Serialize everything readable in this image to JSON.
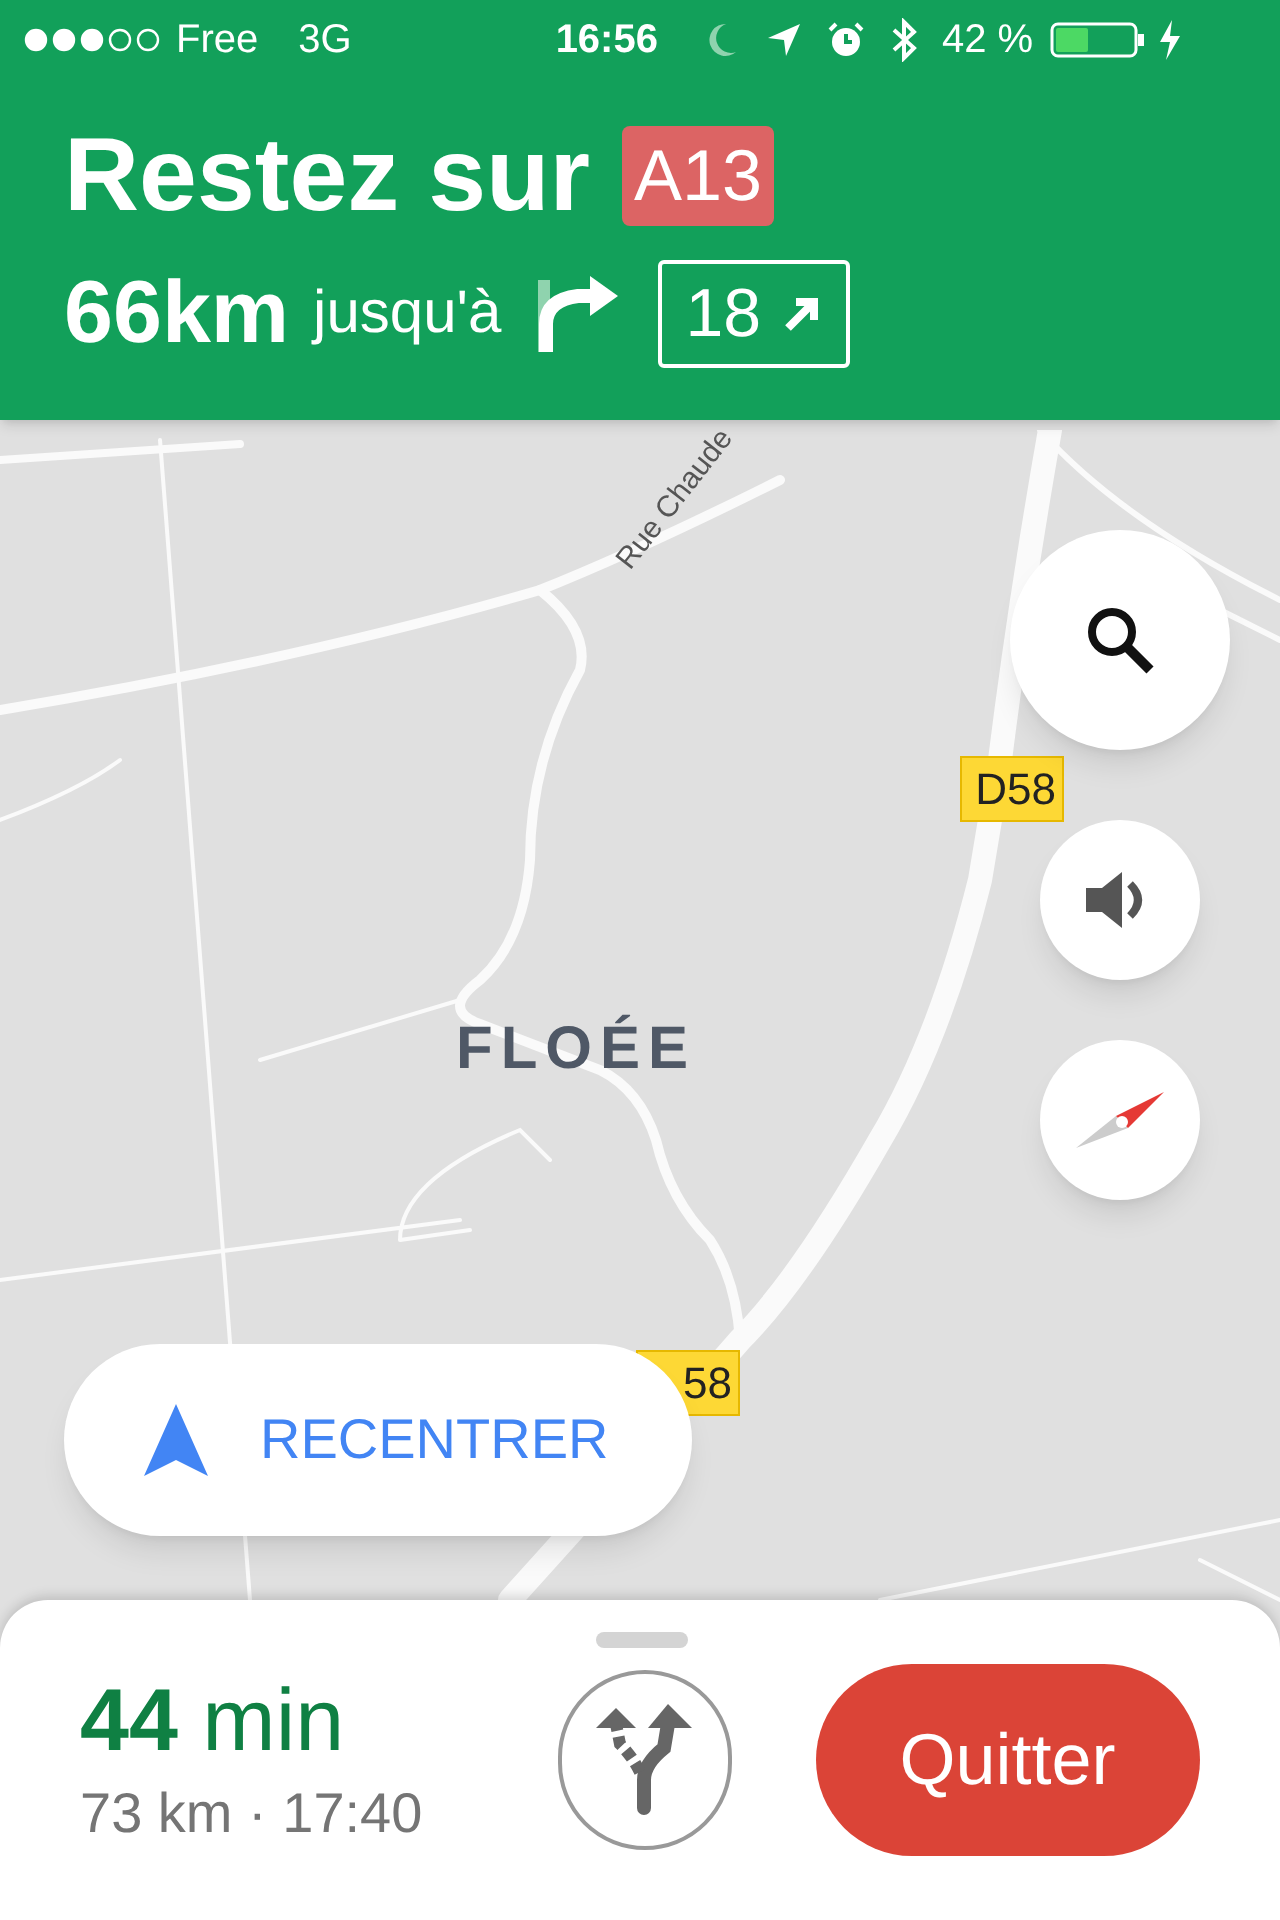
{
  "status_bar": {
    "carrier": "Free",
    "network": "3G",
    "time": "16:56",
    "battery": "42 %"
  },
  "banner": {
    "instruction": "Restez sur",
    "road": "A13",
    "distance": "66km",
    "until": "jusqu'à",
    "exit": "18"
  },
  "map": {
    "labels": [
      {
        "kind": "street",
        "text": "Rue Chaude"
      },
      {
        "kind": "road",
        "text": "D58"
      },
      {
        "kind": "place",
        "text": "FLOÉE"
      },
      {
        "kind": "road",
        "text": "58"
      }
    ]
  },
  "recenter": "RECENTRER",
  "trip": {
    "duration": "**44** min",
    "details": "73 km · 17:40"
  },
  "quit": "Quitter"
}
